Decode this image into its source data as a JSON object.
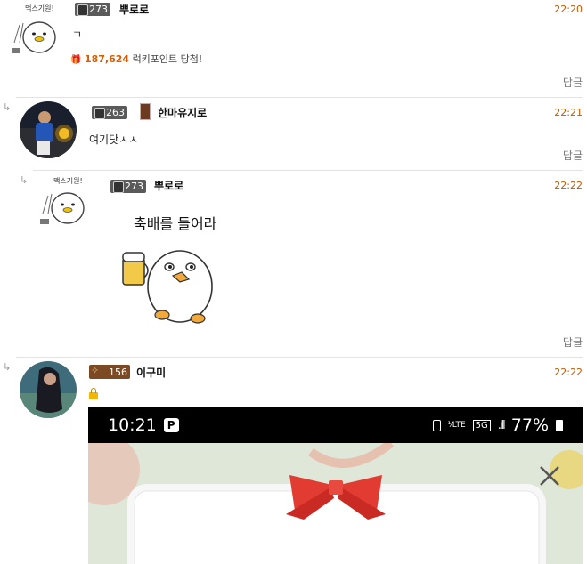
{
  "comments": [
    {
      "level": "273",
      "nickname": "뿌로로",
      "time": "22:20",
      "text": "ㄱ",
      "points_value": "187,624",
      "points_suffix": "럭키포인트 당첨!",
      "reply": "답글",
      "avatar_caption": "맥스기원!"
    },
    {
      "level": "263",
      "nickname": "한마유지로",
      "time": "22:21",
      "text": "여기닷ㅅㅅ",
      "reply": "답글"
    },
    {
      "level": "273",
      "nickname": "뿌로로",
      "time": "22:22",
      "sticker_text": "축배를 들어라",
      "reply": "답글",
      "avatar_caption": "맥스기원!"
    },
    {
      "level": "156",
      "nickname": "이구미",
      "time": "22:22"
    }
  ],
  "phone_screenshot": {
    "clock": "10:21",
    "p_badge": "P",
    "network": "5G",
    "battery": "77%"
  },
  "colors": {
    "time": "#c45a00",
    "points": "#d95d00",
    "ribbon": "#e23b32"
  }
}
